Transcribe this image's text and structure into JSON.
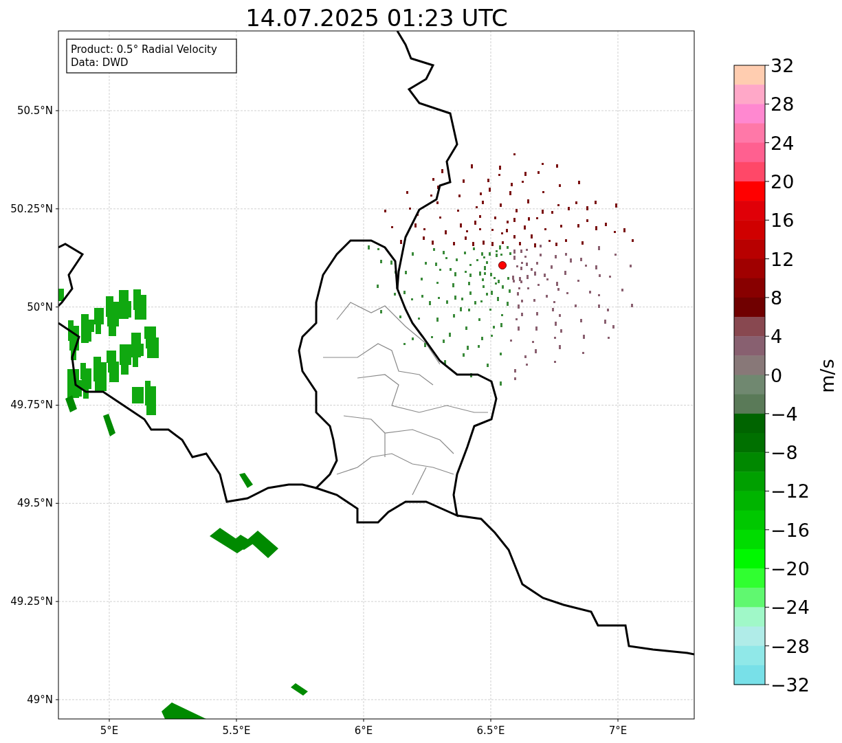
{
  "title": "14.07.2025 01:23 UTC",
  "legend": {
    "lines": [
      "Product: 0.5° Radial Velocity",
      "Data: DWD"
    ]
  },
  "map": {
    "yticks": [
      "50.5°N",
      "50.25°N",
      "50°N",
      "49.75°N",
      "49.5°N",
      "49.25°N",
      "49°N"
    ],
    "xticks": [
      "5°E",
      "5.5°E",
      "6°E",
      "6.5°E",
      "7°E"
    ]
  },
  "colorbar": {
    "label": "m/s",
    "ticks": [
      "32",
      "28",
      "24",
      "20",
      "16",
      "12",
      "8",
      "4",
      "0",
      "−4",
      "−8",
      "−12",
      "−16",
      "−20",
      "−24",
      "−28",
      "−32"
    ],
    "segments": [
      {
        "color": "#ffcdb0"
      },
      {
        "color": "#ffa8c8"
      },
      {
        "color": "#ff88d0"
      },
      {
        "color": "#ff78a8"
      },
      {
        "color": "#ff6090"
      },
      {
        "color": "#ff4868"
      },
      {
        "color": "#ff0000"
      },
      {
        "color": "#e00008"
      },
      {
        "color": "#d00000"
      },
      {
        "color": "#b80000"
      },
      {
        "color": "#a00000"
      },
      {
        "color": "#880000"
      },
      {
        "color": "#700000"
      },
      {
        "color": "#884850"
      },
      {
        "color": "#886070"
      },
      {
        "color": "#887878"
      },
      {
        "color": "#708870"
      },
      {
        "color": "#5a7a58"
      },
      {
        "color": "#006400"
      },
      {
        "color": "#007000"
      },
      {
        "color": "#008800"
      },
      {
        "color": "#00a000"
      },
      {
        "color": "#00b400"
      },
      {
        "color": "#00c800"
      },
      {
        "color": "#00dc00"
      },
      {
        "color": "#00f800"
      },
      {
        "color": "#30ff30"
      },
      {
        "color": "#60f870"
      },
      {
        "color": "#a0f8c8"
      },
      {
        "color": "#b0ece8"
      },
      {
        "color": "#90e8e8"
      },
      {
        "color": "#78e0e8"
      }
    ]
  }
}
